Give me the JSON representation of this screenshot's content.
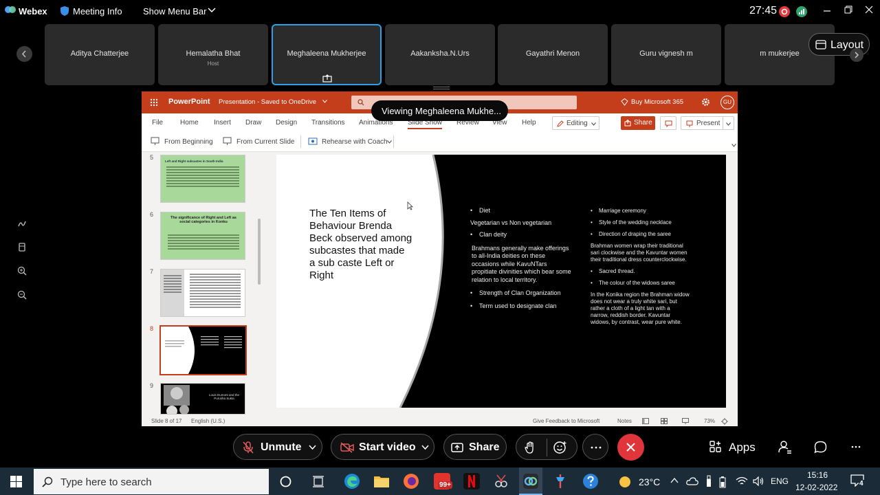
{
  "topbar": {
    "app_name": "Webex",
    "meeting_info": "Meeting Info",
    "show_menu_bar": "Show Menu Bar",
    "timer": "27:45"
  },
  "participants": [
    {
      "name": "Aditya Chatterjee",
      "sub": ""
    },
    {
      "name": "Hemalatha Bhat",
      "sub": "Host"
    },
    {
      "name": "Meghaleena Mukherjee",
      "sub": ""
    },
    {
      "name": "Aakanksha.N.Urs",
      "sub": ""
    },
    {
      "name": "Gayathri Menon",
      "sub": ""
    },
    {
      "name": "Guru vignesh m",
      "sub": ""
    },
    {
      "name": "m mukerjee",
      "sub": ""
    }
  ],
  "layout_button": "Layout",
  "viewing_banner": "Viewing Meghaleena Mukhe...",
  "ppt": {
    "app": "PowerPoint",
    "doc": "Presentation - Saved to OneDrive",
    "buy": "Buy Microsoft 365",
    "avatar": "GU",
    "tabs": [
      "File",
      "Home",
      "Insert",
      "Draw",
      "Design",
      "Transitions",
      "Animations",
      "Slide Show",
      "Review",
      "View",
      "Help"
    ],
    "editing": "Editing",
    "share": "Share",
    "present": "Present",
    "cmds": [
      "From Beginning",
      "From Current Slide",
      "Rehearse with Coach"
    ],
    "thumb_numbers": [
      "5",
      "6",
      "7",
      "8",
      "9"
    ],
    "thumb5_title": "Left and Right subcastes in South India",
    "thumb6_title": "The significance of Right and Left as social categories in Konku",
    "thumb9_title": "Louis Dumont and the Purusha Sukta",
    "slide": {
      "title": "The Ten Items of Behaviour Brenda Beck observed among subcastes that made a sub caste Left or Right",
      "left_items": [
        "Diet",
        "Vegetarian vs Non vegetarian",
        "Clan deity",
        "Brahmans generally make offerings to all-India deities on these occasions while KavuNTars propitiate divinities which bear some relation to local territory.",
        "Strength of Clan Organization",
        "Term used to designate clan"
      ],
      "right_items": [
        "Marriage ceremony",
        "Style of the wedding necklace",
        "Direction of draping the saree",
        "Brahman women wrap their traditional sari clockwise and the Kavuntar women their traditional dress counterclockwise.",
        "Sacred thread.",
        "The colour of the widows saree",
        "In the Konika region the Brahman widow does not wear a truly white sari, but rather a cloth of a light tan with a narrow, reddish border. Kavuntar widows, by contrast, wear pure white."
      ]
    },
    "status": {
      "slide_count": "Slide 8 of 17",
      "language": "English (U.S.)",
      "feedback": "Give Feedback to Microsoft",
      "notes": "Notes",
      "zoom": "73%"
    }
  },
  "controls": {
    "unmute": "Unmute",
    "start_video": "Start video",
    "share": "Share",
    "apps": "Apps"
  },
  "taskbar": {
    "search_placeholder": "Type here to search",
    "badge": "99+",
    "temperature": "23°C",
    "language": "ENG",
    "time": "15:16",
    "date": "12-02-2022",
    "notifications": "4"
  }
}
